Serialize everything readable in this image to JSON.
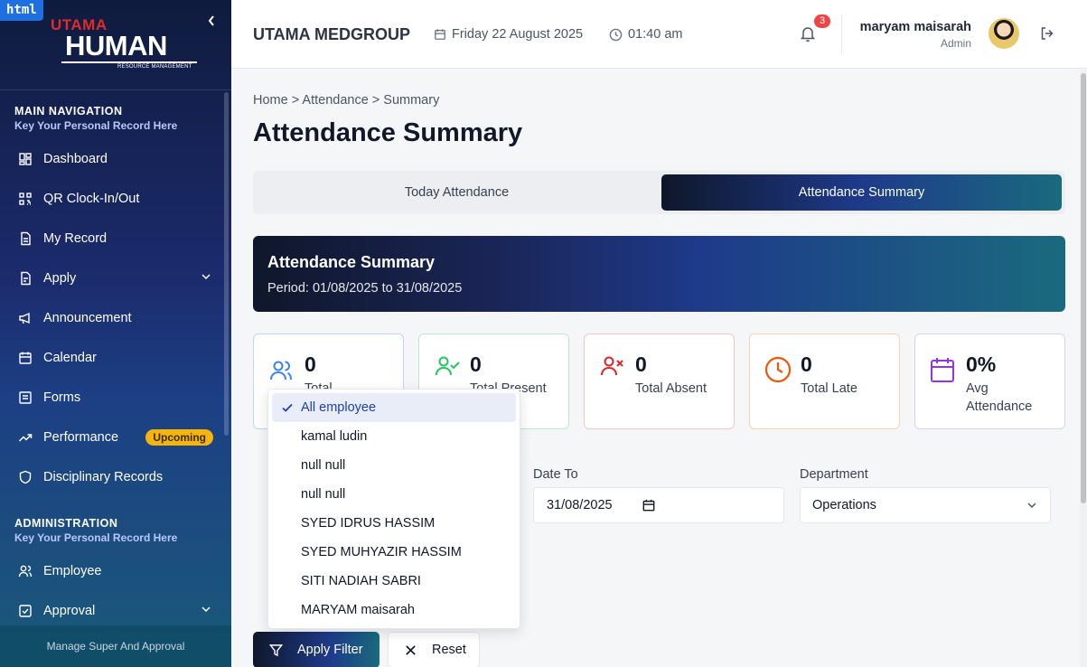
{
  "sidebar": {
    "badge": "html",
    "logo": {
      "brand_top": "UTAMA",
      "brand_main": "HUMAN",
      "brand_sub": "RESOURCE MANAGEMENT"
    },
    "main_nav": {
      "title": "MAIN NAVIGATION",
      "subtitle": "Key Your Personal Record Here"
    },
    "items": [
      {
        "label": "Dashboard",
        "icon": "dashboard-icon"
      },
      {
        "label": "QR Clock-In/Out",
        "icon": "qr-icon"
      },
      {
        "label": "My Record",
        "icon": "document-icon"
      },
      {
        "label": "Apply",
        "icon": "file-icon"
      },
      {
        "label": "Announcement",
        "icon": "megaphone-icon"
      },
      {
        "label": "Calendar",
        "icon": "calendar-icon"
      },
      {
        "label": "Forms",
        "icon": "forms-icon"
      },
      {
        "label": "Performance",
        "icon": "trend-icon",
        "badge": "Upcoming"
      },
      {
        "label": "Disciplinary Records",
        "icon": "shield-icon"
      }
    ],
    "admin": {
      "title": "ADMINISTRATION",
      "subtitle": "Key Your Personal Record Here"
    },
    "admin_items": [
      {
        "label": "Employee",
        "icon": "users-icon"
      },
      {
        "label": "Approval",
        "icon": "checkbox-icon"
      }
    ],
    "footer": "Manage Super And Approval"
  },
  "header": {
    "company": "UTAMA MEDGROUP",
    "date": "Friday 22 August 2025",
    "time": "01:40 am",
    "notifications": "3",
    "user_name": "maryam maisarah",
    "user_role": "Admin"
  },
  "main": {
    "breadcrumb": "Home > Attendance > Summary",
    "title": "Attendance Summary",
    "tabs": [
      {
        "label": "Today Attendance",
        "active": false
      },
      {
        "label": "Attendance Summary",
        "active": true
      }
    ],
    "banner": {
      "title": "Attendance Summary",
      "period": "Period: 01/08/2025 to 31/08/2025"
    },
    "stats": [
      {
        "value": "0",
        "label": "Total",
        "color": "#3b82f6"
      },
      {
        "value": "0",
        "label": "Total Present",
        "color": "#22c55e"
      },
      {
        "value": "0",
        "label": "Total Absent",
        "color": "#dc2626"
      },
      {
        "value": "0",
        "label": "Total Late",
        "color": "#ea580c"
      },
      {
        "value": "0%",
        "label": "Avg Attendance",
        "color": "#9333ea"
      }
    ],
    "filters": {
      "date_to_label": "Date To",
      "date_to_value": "31/08/2025",
      "department_label": "Department",
      "department_value": "Operations"
    },
    "employee_dropdown": {
      "options": [
        "All employee",
        "kamal ludin",
        "null null",
        "null null",
        "SYED IDRUS HASSIM",
        "SYED MUHYAZIR HASSIM",
        "SITI NADIAH SABRI",
        "MARYAM maisarah"
      ],
      "selected": "All employee"
    },
    "buttons": {
      "apply": "Apply Filter",
      "reset": "Reset"
    }
  }
}
